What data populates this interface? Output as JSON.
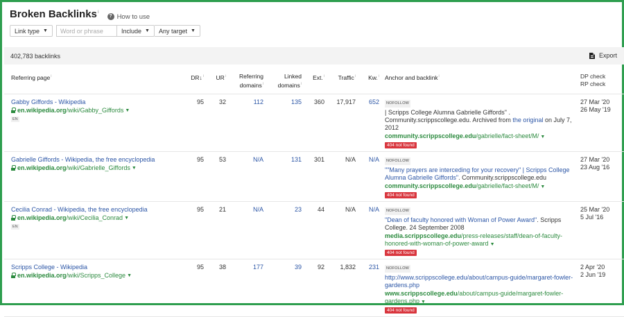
{
  "header": {
    "title": "Broken Backlinks",
    "title_sup": "i",
    "how_to": "How to use"
  },
  "filters": {
    "link_type": "Link type",
    "search_placeholder": "Word or phrase",
    "include": "Include",
    "any_target": "Any target"
  },
  "summary": {
    "count": "402,783 backlinks",
    "export": "Export"
  },
  "columns": {
    "referring_page": "Referring page",
    "dr": "DR",
    "dr_sort": "↓",
    "ur": "UR",
    "referring_domains_1": "Referring",
    "referring_domains_2": "domains",
    "linked_domains_1": "Linked",
    "linked_domains_2": "domains",
    "ext": "Ext.",
    "traffic": "Traffic",
    "kw": "Kw.",
    "anchor": "Anchor and backlink",
    "dp_check": "DP check",
    "rp_check": "RP check"
  },
  "rows": [
    {
      "ref_title": "Gabby Giffords - Wikipedia",
      "ref_host": "en.wikipedia.org",
      "ref_path": "/wiki/Gabby_Giffords",
      "lang": "EN",
      "dr": "95",
      "ur": "32",
      "ref_domains": "112",
      "linked_domains": "135",
      "ext": "360",
      "traffic": "17,917",
      "kw": "652",
      "nofollow": "NOFOLLOW",
      "anchor_pre": "| Scripps College Alumna Gabrielle Giffords\" . Community.scrippscollege.edu. Archived from ",
      "anchor_link": "the original",
      "anchor_post": " on July 7, 2012",
      "target_host": "community.scrippscollege.edu",
      "target_path": "/gabrielle/fact-sheet/M/",
      "status": "404 not found",
      "dp": "27 Mar '20",
      "rp": "26 May '19"
    },
    {
      "ref_title": "Gabrielle Giffords - Wikipedia, the free encyclopedia",
      "ref_host": "en.wikipedia.org",
      "ref_path": "/wiki/Gabrielle_Giffords",
      "lang": "",
      "dr": "95",
      "ur": "53",
      "ref_domains": "N/A",
      "linked_domains": "131",
      "ext": "301",
      "traffic": "N/A",
      "kw": "N/A",
      "nofollow": "NOFOLLOW",
      "anchor_pre": "",
      "anchor_link": "\"\"Many prayers are interceding for your recovery\" | Scripps College Alumna Gabrielle Giffords\"",
      "anchor_post": ". Community.scrippscollege.edu",
      "target_host": "community.scrippscollege.edu",
      "target_path": "/gabrielle/fact-sheet/M/",
      "status": "404 not found",
      "dp": "27 Mar '20",
      "rp": "23 Aug '16"
    },
    {
      "ref_title": "Cecilia Conrad - Wikipedia, the free encyclopedia",
      "ref_host": "en.wikipedia.org",
      "ref_path": "/wiki/Cecilia_Conrad",
      "lang": "EN",
      "dr": "95",
      "ur": "21",
      "ref_domains": "N/A",
      "linked_domains": "23",
      "ext": "44",
      "traffic": "N/A",
      "kw": "N/A",
      "nofollow": "NOFOLLOW",
      "anchor_pre": "",
      "anchor_link": "\"Dean of faculty honored with Woman of Power Award\"",
      "anchor_post": ". Scripps College. 24 September 2008",
      "target_host": "media.scrippscollege.edu",
      "target_path": "/press-releases/staff/dean-of-faculty-honored-with-woman-of-power-award",
      "status": "404 not found",
      "dp": "25 Mar '20",
      "rp": "5 Jul '16"
    },
    {
      "ref_title": "Scripps College - Wikipedia",
      "ref_host": "en.wikipedia.org",
      "ref_path": "/wiki/Scripps_College",
      "lang": "",
      "dr": "95",
      "ur": "38",
      "ref_domains": "177",
      "linked_domains": "39",
      "ext": "92",
      "traffic": "1,832",
      "kw": "231",
      "nofollow": "NOFOLLOW",
      "anchor_pre": "",
      "anchor_link": "http://www.scrippscollege.edu/about/campus-guide/margaret-fowler-gardens.php",
      "anchor_post": "",
      "target_host": "www.scrippscollege.edu",
      "target_path": "/about/campus-guide/margaret-fowler-gardens.php",
      "status": "404 not found",
      "dp": "2 Apr '20",
      "rp": "2 Jun '19"
    }
  ],
  "colors": {
    "frame": "#2e9e4f",
    "link": "#2c56a6",
    "url_green": "#2b8a3e",
    "badge_red": "#d9363e"
  }
}
